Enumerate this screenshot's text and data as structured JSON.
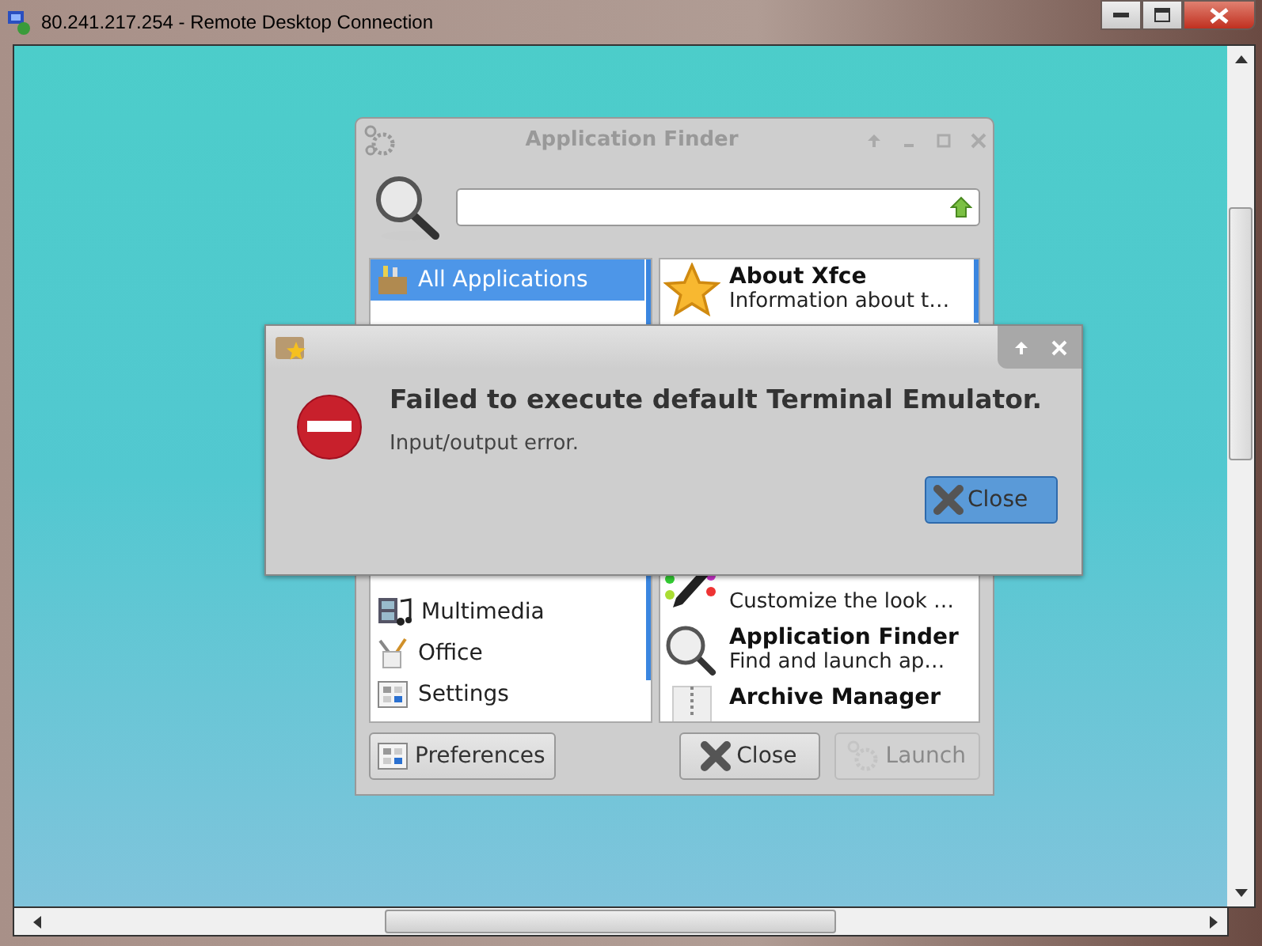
{
  "window": {
    "title": "80.241.217.254 - Remote Desktop Connection"
  },
  "finder": {
    "title": "Application Finder",
    "categories_top": [
      {
        "label": "All Applications",
        "selected": true
      }
    ],
    "categories_bottom": [
      {
        "label": "Multimedia",
        "selected": false
      },
      {
        "label": "Office",
        "selected": false
      },
      {
        "label": "Settings",
        "selected": false
      }
    ],
    "apps_top": [
      {
        "name": "About Xfce",
        "description": "Information about t…"
      }
    ],
    "apps_bottom": [
      {
        "description": "Customize the look …"
      },
      {
        "name": "Application Finder",
        "description": "Find and launch ap…"
      },
      {
        "name": "Archive Manager"
      }
    ],
    "buttons": [
      {
        "label": "Preferences",
        "kind": "prefs",
        "disabled": false
      },
      {
        "label": "Close",
        "kind": "close",
        "disabled": false
      },
      {
        "label": "Launch",
        "kind": "launch",
        "disabled": true
      }
    ]
  },
  "dialog": {
    "heading": "Failed to execute default Terminal Emulator.",
    "message": "Input/output error.",
    "button": "Close"
  }
}
